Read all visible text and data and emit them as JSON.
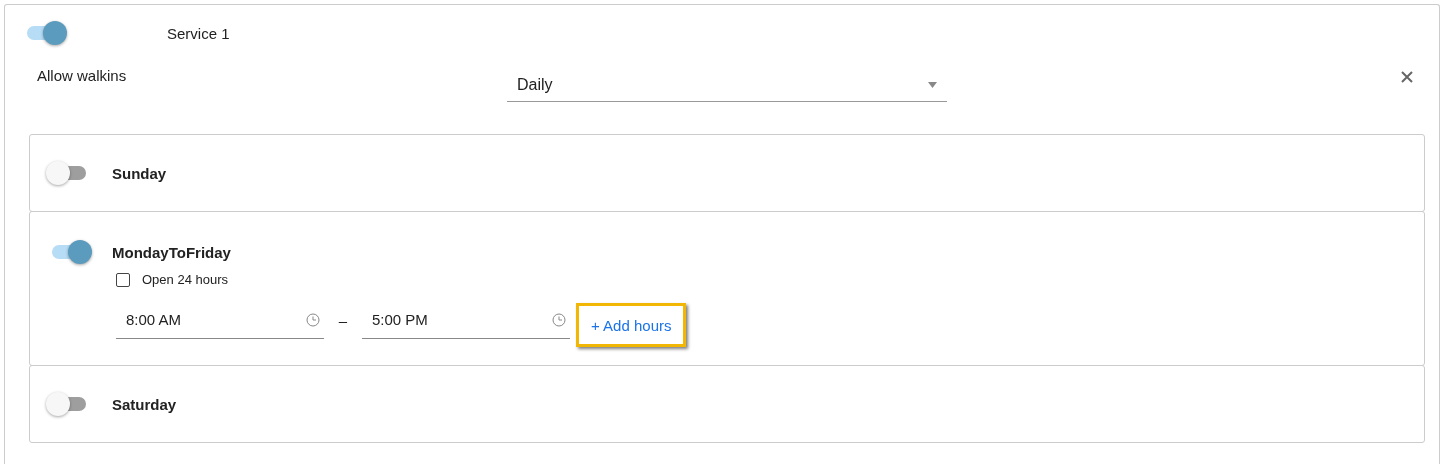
{
  "service": {
    "name": "Service 1",
    "on": true
  },
  "allow_walkins": {
    "label": "Allow walkins"
  },
  "frequency": {
    "value": "Daily"
  },
  "days": [
    {
      "name": "Sunday",
      "on": false
    },
    {
      "name": "MondayToFriday",
      "on": true,
      "open_24_hours": {
        "label": "Open 24 hours",
        "checked": false
      },
      "hours": [
        {
          "start": "8:00 AM",
          "separator": "–",
          "end": "5:00 PM"
        }
      ],
      "add_hours": {
        "label": "+ Add hours",
        "highlighted": true
      }
    },
    {
      "name": "Saturday",
      "on": false
    }
  ]
}
